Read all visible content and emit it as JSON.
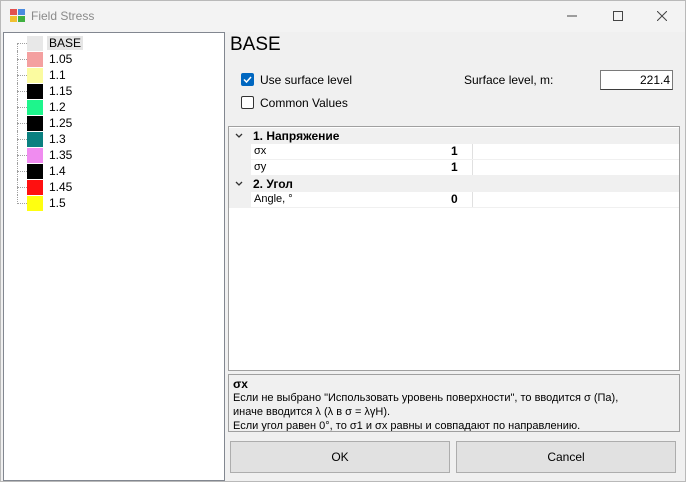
{
  "window": {
    "title": "Field Stress"
  },
  "tree": {
    "items": [
      {
        "label": "BASE",
        "color": "#e8e8e8",
        "selected": true
      },
      {
        "label": "1.05",
        "color": "#f4a0a0"
      },
      {
        "label": "1.1",
        "color": "#fbfba0"
      },
      {
        "label": "1.15",
        "color": "#000000"
      },
      {
        "label": "1.2",
        "color": "#1ef58c"
      },
      {
        "label": "1.25",
        "color": "#000000"
      },
      {
        "label": "1.3",
        "color": "#0a8080"
      },
      {
        "label": "1.35",
        "color": "#f08cf0"
      },
      {
        "label": "1.4",
        "color": "#000000"
      },
      {
        "label": "1.45",
        "color": "#ff1010"
      },
      {
        "label": "1.5",
        "color": "#ffff10"
      }
    ]
  },
  "panel": {
    "heading": "BASE",
    "use_surface_level": {
      "label": "Use surface level",
      "checked": true
    },
    "common_values": {
      "label": "Common Values",
      "checked": false
    },
    "surface_level": {
      "label": "Surface level, m:",
      "value": "221.4"
    }
  },
  "grid": {
    "cat1": {
      "label": "1. Напряжение"
    },
    "sx": {
      "name": "σx",
      "value": "1"
    },
    "sy": {
      "name": "σy",
      "value": "1"
    },
    "cat2": {
      "label": "2. Угол"
    },
    "angle": {
      "name": "Angle, °",
      "value": "0"
    }
  },
  "description": {
    "title": "σx",
    "line1": "Если не выбрано \"Использовать уровень поверхности\", то вводится σ (Па),",
    "line2": "иначе вводится λ (λ в σ = λγH).",
    "line3": "Если угол равен 0°, то σ1 и σx равны и совпадают по направлению."
  },
  "buttons": {
    "ok": "OK",
    "cancel": "Cancel"
  },
  "icons": {
    "app": "app-grid-icon",
    "minimize": "minimize-icon",
    "maximize": "maximize-icon",
    "close": "close-icon",
    "check": "checkmark-icon",
    "collapse": "chevron-down-icon"
  }
}
